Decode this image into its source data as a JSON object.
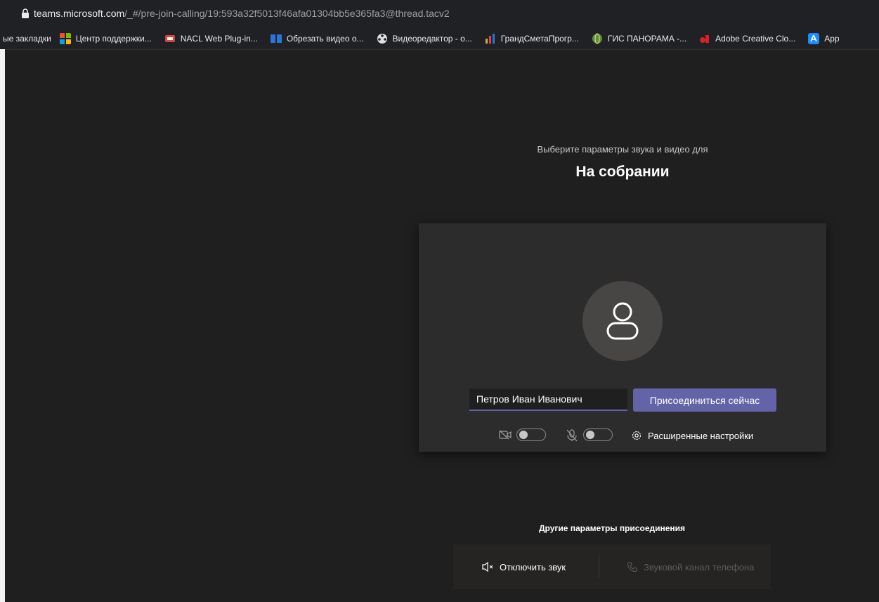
{
  "browser": {
    "url_host": "teams.microsoft.com",
    "url_path": "/_#/pre-join-calling/19:593a32f5013f46afa01304bb5e365fa3@thread.tacv2"
  },
  "bookmarks": [
    {
      "label": "ые закладки",
      "icon": "none"
    },
    {
      "label": "Центр поддержки...",
      "icon": "microsoft-logo"
    },
    {
      "label": "NACL Web Plug-in...",
      "icon": "red-app-icon"
    },
    {
      "label": "Обрезать видео о...",
      "icon": "blue-app-icon"
    },
    {
      "label": "Видеоредактор - о...",
      "icon": "film-reel-icon"
    },
    {
      "label": "ГрандСметаПрогр...",
      "icon": "chart-icon"
    },
    {
      "label": "ГИС ПАНОРАМА -...",
      "icon": "globe-icon"
    },
    {
      "label": "Adobe Creative Clo...",
      "icon": "adobe-icon"
    },
    {
      "label": "App",
      "icon": "app-store-icon"
    }
  ],
  "prejoin": {
    "subtitle": "Выберите параметры звука и видео для",
    "title": "На собрании",
    "name_value": "Петров Иван Иванович",
    "join_label": "Присоединиться сейчас",
    "camera_toggle": "off",
    "mic_toggle": "off",
    "advanced_settings_label": "Расширенные настройки"
  },
  "other_options": {
    "label": "Другие параметры присоединения",
    "mute_label": "Отключить звук",
    "phone_label": "Звуковой канал телефона"
  },
  "colors": {
    "accent": "#6264a7",
    "background": "#1f1f1f",
    "card": "#2d2c2c"
  }
}
